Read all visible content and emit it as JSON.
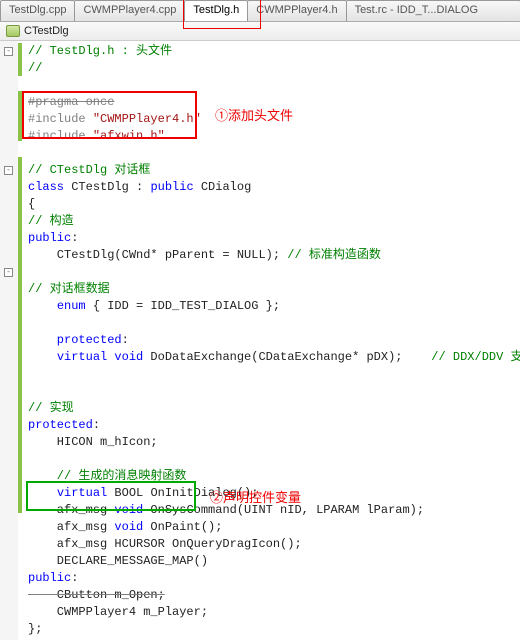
{
  "tabs": {
    "items": [
      "TestDlg.cpp",
      "CWMPPlayer4.cpp",
      "TestDlg.h",
      "CWMPPlayer4.h",
      "Test.rc - IDD_T...DIALOG"
    ],
    "active": 2
  },
  "classbar": {
    "name": "CTestDlg"
  },
  "annotations": {
    "a1": "①添加头文件",
    "a2": "②声明控件变量"
  },
  "code": {
    "l1a": "// TestDlg.h : 头文件",
    "l1b": "//",
    "l2": "#pragma once",
    "l3a": "#include ",
    "l3b": "\"CWMPPlayer4.h\"",
    "l4a": "#include ",
    "l4b": "\"afxwin.h\"",
    "l5": "// CTestDlg 对话框",
    "l6a": "class",
    "l6b": " CTestDlg : ",
    "l6c": "public",
    "l6d": " CDialog",
    "l7": "{",
    "l8": "// 构造",
    "l9": "public",
    "l9b": ":",
    "l10a": "    CTestDlg(CWnd* pParent = NULL); ",
    "l10b": "// 标准构造函数",
    "l11": "// 对话框数据",
    "l12a": "    ",
    "l12b": "enum",
    "l12c": " { IDD = IDD_TEST_DIALOG };",
    "l13": "    protected",
    "l13b": ":",
    "l14a": "    ",
    "l14b": "virtual void",
    "l14c": " DoDataExchange(CDataExchange* pDX);    ",
    "l14d": "// DDX/DDV 支持",
    "l15": "// 实现",
    "l16": "protected",
    "l16b": ":",
    "l17": "    HICON m_hIcon;",
    "l18": "    // 生成的消息映射函数",
    "l19a": "    ",
    "l19b": "virtual",
    "l19c": " BOOL OnInitDialog();",
    "l20a": "    afx_msg ",
    "l20b": "void",
    "l20c": " OnSysCommand(UINT nID, LPARAM lParam);",
    "l21a": "    afx_msg ",
    "l21b": "void",
    "l21c": " OnPaint();",
    "l22": "    afx_msg HCURSOR OnQueryDragIcon();",
    "l23": "    DECLARE_MESSAGE_MAP()",
    "l24": "public",
    "l24b": ":",
    "l25": "    CButton m_Open;",
    "l26": "    CWMPPlayer4 m_Player;",
    "l27": "};"
  }
}
